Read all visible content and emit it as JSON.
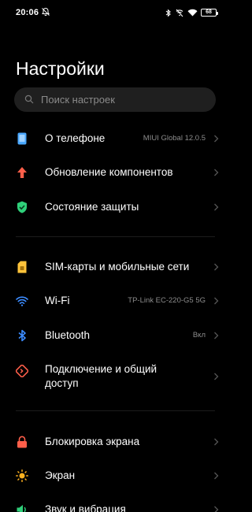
{
  "status_bar": {
    "time": "20:06",
    "battery": "68"
  },
  "title": "Настройки",
  "search": {
    "placeholder": "Поиск настроек"
  },
  "groups": [
    {
      "items": [
        {
          "label": "О телефоне",
          "value": "MIUI Global 12.0.5",
          "icon": "phone-info-icon",
          "color": "#4aa8ff"
        },
        {
          "label": "Обновление компонентов",
          "value": "",
          "icon": "arrow-up-icon",
          "color": "#ff5f4a"
        },
        {
          "label": "Состояние защиты",
          "value": "",
          "icon": "shield-check-icon",
          "color": "#2fd07a"
        }
      ]
    },
    {
      "items": [
        {
          "label": "SIM-карты и мобильные сети",
          "value": "",
          "icon": "sim-card-icon",
          "color": "#ffc43a"
        },
        {
          "label": "Wi-Fi",
          "value": "TP-Link EC-220-G5 5G",
          "icon": "wifi-icon",
          "color": "#3c8cff"
        },
        {
          "label": "Bluetooth",
          "value": "Вкл",
          "icon": "bluetooth-icon",
          "color": "#3c8cff"
        },
        {
          "label": "Подключение и общий доступ",
          "value": "",
          "icon": "connection-share-icon",
          "color": "#ff5f4a"
        }
      ]
    },
    {
      "items": [
        {
          "label": "Блокировка экрана",
          "value": "",
          "icon": "lock-icon",
          "color": "#ff5f4a"
        },
        {
          "label": "Экран",
          "value": "",
          "icon": "sun-icon",
          "color": "#ffb21f"
        },
        {
          "label": "Звук и вибрация",
          "value": "",
          "icon": "sound-icon",
          "color": "#2fd07a"
        }
      ]
    }
  ]
}
